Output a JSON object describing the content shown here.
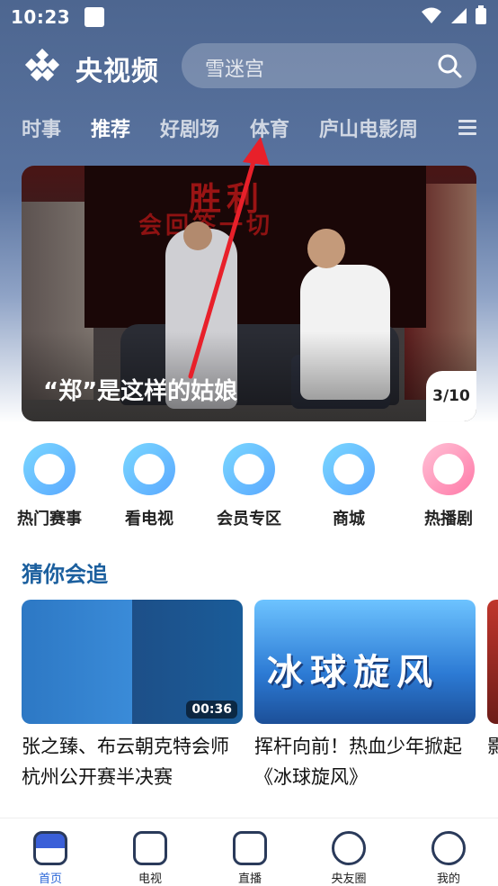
{
  "status_bar": {
    "time": "10:23"
  },
  "header": {
    "brand": "央视频",
    "search_placeholder": "雪迷宫"
  },
  "tabs": [
    {
      "label": "时事"
    },
    {
      "label": "推荐",
      "active": true
    },
    {
      "label": "好剧场"
    },
    {
      "label": "体育"
    },
    {
      "label": "庐山电影周"
    }
  ],
  "banner": {
    "headline_line1": "胜利",
    "headline_line2": "会回答一切",
    "caption": "“郑”是这样的姑娘",
    "counter": "3/10"
  },
  "quick_links": [
    {
      "label": "热门赛事",
      "icon": "trophy-icon"
    },
    {
      "label": "看电视",
      "icon": "tv-icon"
    },
    {
      "label": "会员专区",
      "icon": "vip-icon"
    },
    {
      "label": "商城",
      "icon": "cart-icon"
    },
    {
      "label": "热播剧",
      "icon": "hot-icon"
    }
  ],
  "section": {
    "title": "猜你会追"
  },
  "cards": [
    {
      "title": "张之臻、布云朝克特会师杭州公开赛半决赛",
      "duration": "00:36"
    },
    {
      "title": "挥杆向前！热血少年掀起《冰球旋风》",
      "thumb_text": "冰球旋风"
    },
    {
      "title": "影师"
    }
  ],
  "bottom_nav": [
    {
      "label": "首页",
      "active": true,
      "icon": "home-icon"
    },
    {
      "label": "电视",
      "icon": "tv-icon"
    },
    {
      "label": "直播",
      "icon": "live-icon"
    },
    {
      "label": "央友圈",
      "icon": "compass-icon"
    },
    {
      "label": "我的",
      "icon": "profile-icon"
    }
  ],
  "colors": {
    "accent": "#1b5f9e",
    "nav_active": "#2a66d8",
    "annotation_arrow": "#e8202a"
  }
}
